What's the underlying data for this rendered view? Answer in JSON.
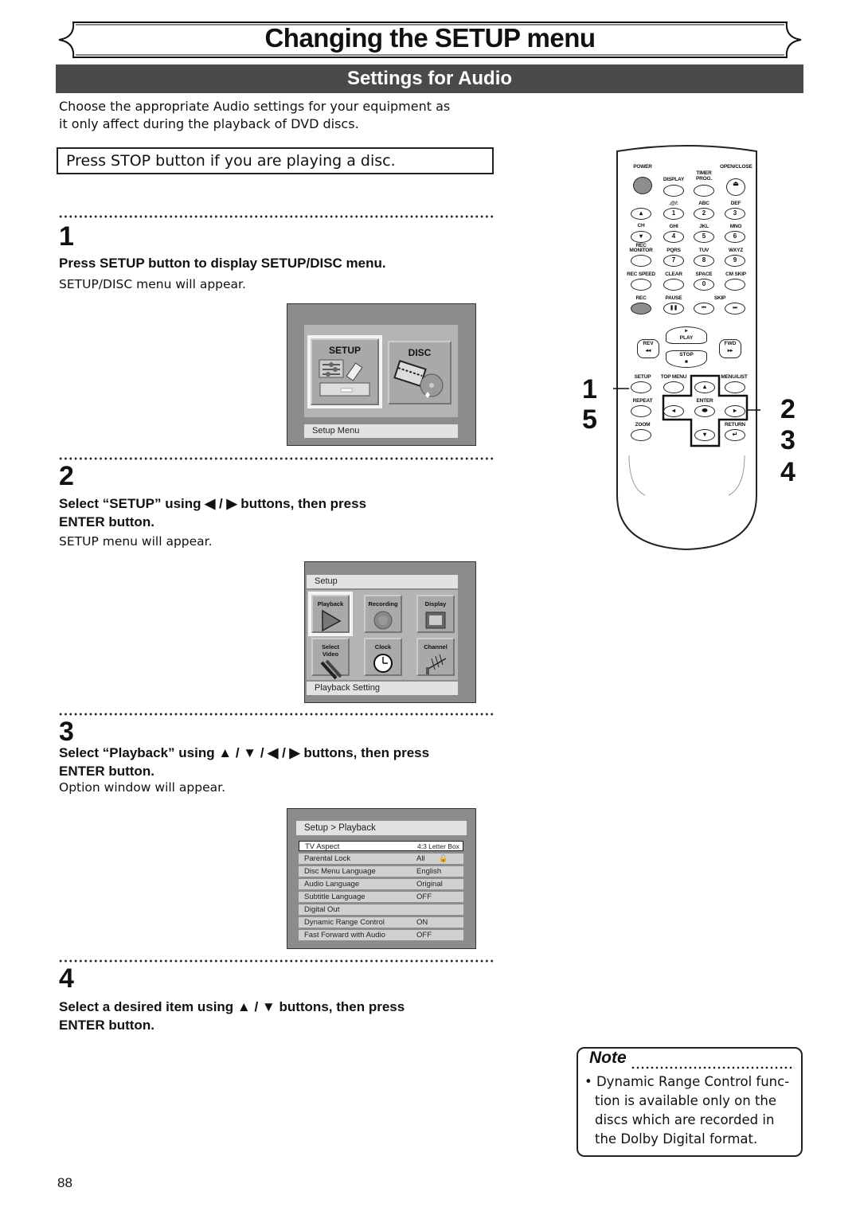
{
  "header": {
    "title": "Changing the SETUP menu",
    "section": "Settings for Audio"
  },
  "intro": {
    "text_line1": "Choose the appropriate Audio settings for your equipment as",
    "text_line2": "it only affect during the playback of DVD discs.",
    "stop_notice": "Press STOP button if you are playing a disc."
  },
  "steps": [
    {
      "number": "1",
      "instruction": "Press SETUP button to display SETUP/DISC menu.",
      "result": "SETUP/DISC menu will appear."
    },
    {
      "number": "2",
      "instruction_line1": "Select “SETUP” using ◀ / ▶ buttons, then press",
      "instruction_line2": "ENTER button.",
      "result": "SETUP menu will appear."
    },
    {
      "number": "3",
      "instruction_line1": "Select “Playback” using ▲ / ▼ / ◀ / ▶ buttons, then press",
      "instruction_line2": "ENTER button.",
      "result": "Option window will appear."
    },
    {
      "number": "4",
      "instruction_line1": "Select a desired item using ▲ / ▼ buttons, then press",
      "instruction_line2": "ENTER button."
    }
  ],
  "screen_setup_disc": {
    "tiles": [
      {
        "label": "SETUP",
        "icon": "setup-equalizer-icon",
        "selected": true
      },
      {
        "label": "DISC",
        "icon": "film-disc-icon",
        "selected": false
      }
    ],
    "status": "Setup Menu"
  },
  "screen_setup": {
    "title": "Setup",
    "tiles": [
      {
        "label": "Playback",
        "icon": "play-icon",
        "selected": true
      },
      {
        "label": "Recording",
        "icon": "record-icon",
        "selected": false
      },
      {
        "label": "Display",
        "icon": "display-panel-icon",
        "selected": false
      },
      {
        "label": "Select Video",
        "icon": "video-cable-icon",
        "selected": false
      },
      {
        "label": "Clock",
        "icon": "clock-icon",
        "selected": false
      },
      {
        "label": "Channel",
        "icon": "antenna-icon",
        "selected": false
      }
    ],
    "status": "Playback Setting"
  },
  "screen_playback": {
    "breadcrumb": "Setup > Playback",
    "options": [
      {
        "label": "TV Aspect",
        "value": "4:3 Letter Box",
        "selected": true
      },
      {
        "label": "Parental Lock",
        "value": "All",
        "icon": "lock-icon"
      },
      {
        "label": "Disc Menu Language",
        "value": "English"
      },
      {
        "label": "Audio Language",
        "value": "Original"
      },
      {
        "label": "Subtitle Language",
        "value": "OFF"
      },
      {
        "label": "Digital Out",
        "value": ""
      },
      {
        "label": "Dynamic Range Control",
        "value": "ON"
      },
      {
        "label": "Fast Forward with Audio",
        "value": "OFF"
      }
    ]
  },
  "remote": {
    "labels": {
      "power": "POWER",
      "display": "DISPLAY",
      "timer_prog": "TIMER PROG.",
      "open_close": "OPEN/CLOSE",
      "at": ".@/:",
      "abc": "ABC",
      "def": "DEF",
      "ch": "CH",
      "ghi": "GHI",
      "jkl": "JKL",
      "mno": "MNO",
      "rec_monitor": "REC MONITOR",
      "pqrs": "PQRS",
      "tuv": "TUV",
      "wxyz": "WXYZ",
      "rec_speed": "REC SPEED",
      "clear": "CLEAR",
      "space": "SPACE",
      "cm_skip": "CM SKIP",
      "rec": "REC",
      "pause": "PAUSE",
      "skip": "SKIP",
      "play": "PLAY",
      "rev": "REV",
      "fwd": "FWD",
      "stop": "STOP",
      "setup": "SETUP",
      "top_menu": "TOP MENU",
      "menu_list": "MENU/LIST",
      "repeat": "REPEAT",
      "enter": "ENTER",
      "zoom": "ZOOM",
      "return": "RETURN"
    },
    "digits": [
      "1",
      "2",
      "3",
      "4",
      "5",
      "6",
      "7",
      "8",
      "9",
      "0"
    ],
    "callouts_left": [
      "1",
      "5"
    ],
    "callouts_right": [
      "2",
      "3",
      "4"
    ]
  },
  "note": {
    "title": "Note",
    "text": "• Dynamic Range Control function is available only on the discs which are recorded in the Dolby Digital format.",
    "lines": [
      "• Dynamic Range Control func-",
      "tion is available only on the",
      "discs which are recorded in",
      "the Dolby Digital format."
    ]
  },
  "page_number": "88"
}
